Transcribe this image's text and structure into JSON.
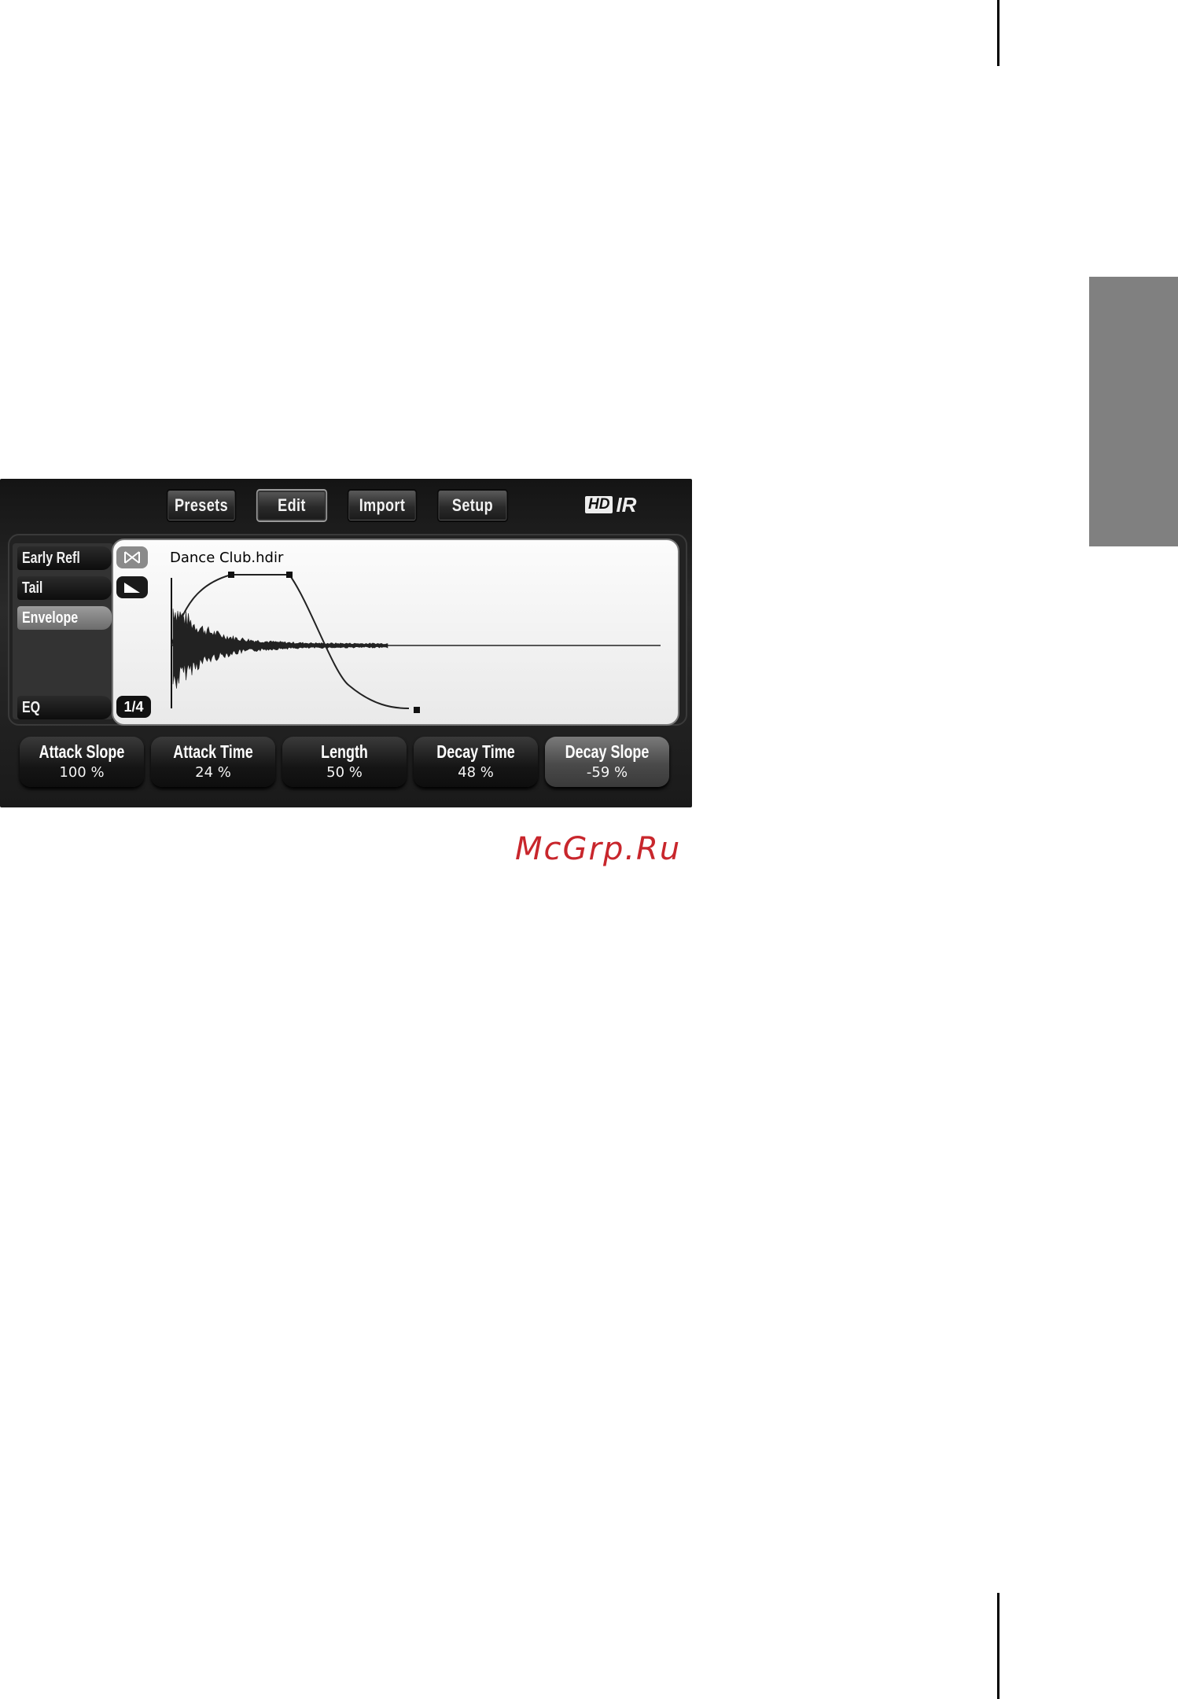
{
  "plugin": {
    "toolbar": {
      "buttons": [
        {
          "label": "Presets"
        },
        {
          "label": "Edit",
          "active": true
        },
        {
          "label": "Import"
        },
        {
          "label": "Setup"
        }
      ],
      "logo": {
        "hd": "HD",
        "ir": "IR"
      }
    },
    "sidebar": {
      "items": [
        {
          "label": "Early Refl"
        },
        {
          "label": "Tail"
        },
        {
          "label": "Envelope",
          "active": true
        },
        {
          "label": "EQ"
        }
      ]
    },
    "display": {
      "filename": "Dance Club.hdir",
      "page_indicator": "1/4",
      "icons": [
        "bowtie-icon",
        "ramp-icon"
      ]
    },
    "params": [
      {
        "label": "Attack Slope",
        "value": "100 %"
      },
      {
        "label": "Attack Time",
        "value": "24 %"
      },
      {
        "label": "Length",
        "value": "50 %"
      },
      {
        "label": "Decay Time",
        "value": "48 %"
      },
      {
        "label": "Decay Slope",
        "value": "-59 %"
      }
    ]
  },
  "watermark": "McGrp.Ru"
}
